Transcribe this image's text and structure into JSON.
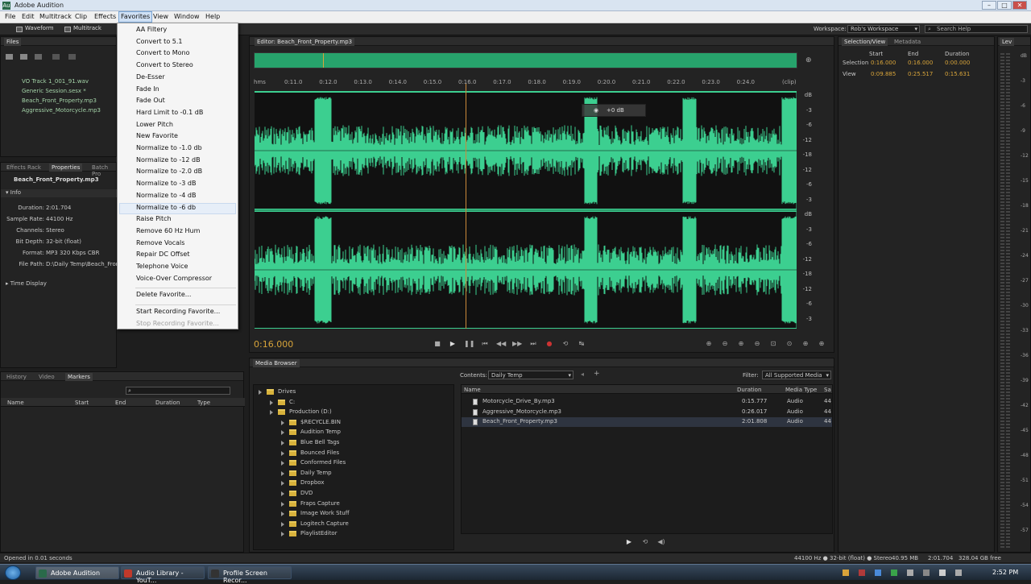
{
  "window": {
    "title": "Adobe Audition",
    "controls": [
      "–",
      "□",
      "✕"
    ]
  },
  "menubar": {
    "items": [
      "File",
      "Edit",
      "Multitrack",
      "Clip",
      "Effects",
      "Favorites",
      "View",
      "Window",
      "Help"
    ]
  },
  "toolbar": {
    "waveform": "Waveform",
    "multitrack": "Multitrack",
    "workspace_label": "Workspace:",
    "workspace_value": "Rob's Workspace",
    "search_placeholder": "Search Help"
  },
  "files": {
    "tab": "Files",
    "items": [
      "VO Track 1_001_91.wav",
      "Generic Session.sesx *",
      "Beach_Front_Property.mp3",
      "Aggressive_Motorcycle.mp3"
    ]
  },
  "properties": {
    "tabs": [
      "Effects Rack",
      "Properties",
      "Batch Pro"
    ],
    "filename": "Beach_Front_Property.mp3",
    "info_header": "Info",
    "info": [
      {
        "label": "Duration:",
        "value": "2:01.704"
      },
      {
        "label": "Sample Rate:",
        "value": "44100 Hz"
      },
      {
        "label": "Channels:",
        "value": "Stereo"
      },
      {
        "label": "Bit Depth:",
        "value": "32-bit (float)"
      },
      {
        "label": "Format:",
        "value": "MP3 320 Kbps CBR"
      },
      {
        "label": "File Path:",
        "value": "D:\\Daily Temp\\Beach_Front_"
      }
    ],
    "time_display": "Time Display"
  },
  "favorites_menu": {
    "groups": [
      [
        "AA Filtery",
        "Convert to 5.1",
        "Convert to Mono",
        "Convert to Stereo",
        "De-Esser",
        "Fade In",
        "Fade Out",
        "Hard Limit to -0.1 dB",
        "Lower Pitch",
        "New Favorite",
        "Normalize to -1.0 db",
        "Normalize to -12 dB",
        "Normalize to -2.0 dB",
        "Normalize to -3 dB",
        "Normalize to -4 dB",
        "Normalize to -6 db",
        "Raise Pitch",
        "Remove 60 Hz Hum",
        "Remove Vocals",
        "Repair DC Offset",
        "Telephone Voice",
        "Voice-Over Compressor"
      ],
      [
        "Delete Favorite..."
      ],
      [
        "Start Recording Favorite..."
      ]
    ],
    "disabled": "Stop Recording Favorite...",
    "highlighted": "Normalize to -6 db"
  },
  "editor": {
    "tab": "Editor: Beach_Front_Property.mp3",
    "ruler": [
      "hms",
      "0:11.0",
      "0:12.0",
      "0:13.0",
      "0:14.0",
      "0:15.0",
      "0:16.0",
      "0:17.0",
      "0:18.0",
      "0:19.0",
      "0:20.0",
      "0:21.0",
      "0:22.0",
      "0:23.0",
      "0:24.0",
      "(clip)"
    ],
    "db_labels": [
      "dB",
      "-3",
      "-6",
      "-12",
      "-18",
      "-12",
      "-6",
      "-3",
      "dB",
      "-3",
      "-6",
      "-12",
      "-18",
      "-12",
      "-6",
      "-3"
    ],
    "volume_hud": "+0 dB",
    "time": "0:16.000",
    "playhead_fraction": 0.39
  },
  "selection_view": {
    "tabs": [
      "Selection/View",
      "Metadata"
    ],
    "headers": [
      "Start",
      "End",
      "Duration"
    ],
    "rows": [
      {
        "label": "Selection",
        "start": "0:16.000",
        "end": "0:16.000",
        "duration": "0:00.000"
      },
      {
        "label": "View",
        "start": "0:09.885",
        "end": "0:25.517",
        "duration": "0:15.631"
      }
    ]
  },
  "levels": {
    "tab": "Lev",
    "scale": [
      "dB",
      "-3",
      "-6",
      "-9",
      "-12",
      "-15",
      "-18",
      "-21",
      "-24",
      "-27",
      "-30",
      "-33",
      "-36",
      "-39",
      "-42",
      "-45",
      "-48",
      "-51",
      "-54",
      "-57"
    ]
  },
  "markers": {
    "tabs": [
      "History",
      "Video",
      "Markers"
    ],
    "columns": [
      "Name",
      "Start",
      "End",
      "Duration",
      "Type"
    ]
  },
  "media_browser": {
    "tab": "Media Browser",
    "contents_label": "Contents:",
    "contents_value": "Daily Temp",
    "filter_label": "Filter:",
    "filter_value": "All Supported Media",
    "tree": [
      {
        "label": "Drives",
        "level": 0
      },
      {
        "label": "C:",
        "level": 1
      },
      {
        "label": "Production (D:)",
        "level": 1
      },
      {
        "label": "$RECYCLE.BIN",
        "level": 2
      },
      {
        "label": "Audition Temp",
        "level": 2
      },
      {
        "label": "Blue Bell Tags",
        "level": 2
      },
      {
        "label": "Bounced Files",
        "level": 2
      },
      {
        "label": "Conformed Files",
        "level": 2
      },
      {
        "label": "Daily Temp",
        "level": 2
      },
      {
        "label": "Dropbox",
        "level": 2
      },
      {
        "label": "DVD",
        "level": 2
      },
      {
        "label": "Fraps Capture",
        "level": 2
      },
      {
        "label": "Image Work Stuff",
        "level": 2
      },
      {
        "label": "Logitech Capture",
        "level": 2
      },
      {
        "label": "PlaylistEditor",
        "level": 2
      }
    ],
    "columns": [
      "Name",
      "Duration",
      "Media Type",
      "Sa"
    ],
    "files": [
      {
        "name": "Motorcycle_Drive_By.mp3",
        "duration": "0:15.777",
        "type": "Audio",
        "sr": "44"
      },
      {
        "name": "Aggressive_Motorcycle.mp3",
        "duration": "0:26.017",
        "type": "Audio",
        "sr": "44"
      },
      {
        "name": "Beach_Front_Property.mp3",
        "duration": "2:01.808",
        "type": "Audio",
        "sr": "44"
      }
    ]
  },
  "status": {
    "left": "Opened in 0.01 seconds",
    "format": "44100 Hz ● 32-bit (float) ● Stereo",
    "size": "40.95 MB",
    "duration": "2:01.704",
    "free": "328.04 GB free"
  },
  "taskbar": {
    "items": [
      "Adobe Audition",
      "Audio Library - YouT...",
      "Profile Screen Recor..."
    ],
    "clock": "2:52 PM"
  }
}
